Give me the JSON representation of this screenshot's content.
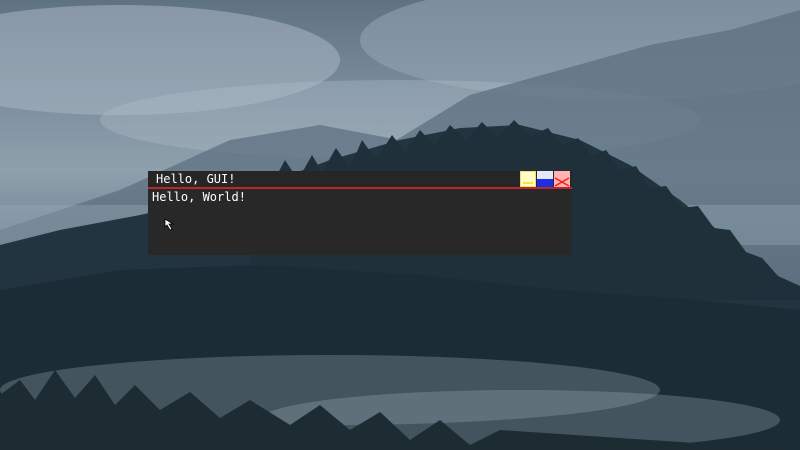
{
  "window": {
    "title": "Hello, GUI!",
    "content_text": "Hello, World!",
    "accent_color": "#b8262e"
  },
  "controls": {
    "minimize_icon": "minimize-icon",
    "maximize_icon": "maximize-icon",
    "close_icon": "close-icon"
  },
  "desktop": {
    "wallpaper": "misty-forest-mountains"
  },
  "pointer": {
    "icon": "arrow-cursor-icon"
  }
}
